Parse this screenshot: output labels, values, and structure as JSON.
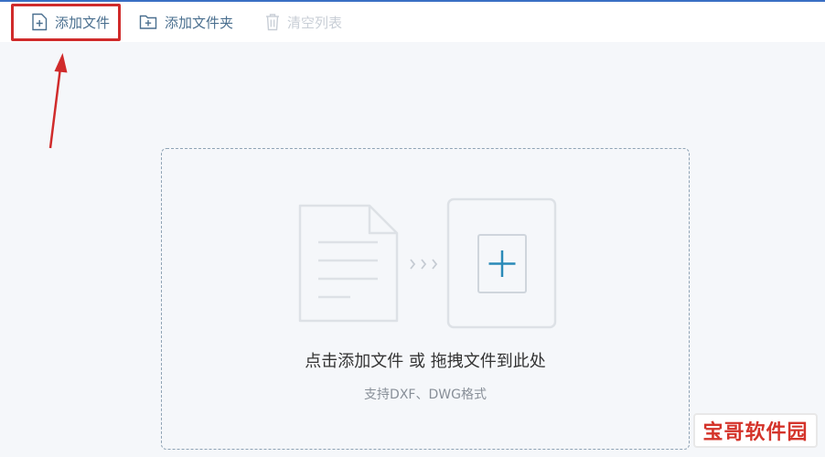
{
  "toolbar": {
    "add_file": "添加文件",
    "add_folder": "添加文件夹",
    "clear_list": "清空列表"
  },
  "drop_zone": {
    "title": "点击添加文件 或 拖拽文件到此处",
    "subtitle": "支持DXF、DWG格式"
  },
  "watermark": {
    "text": "宝哥软件园"
  },
  "colors": {
    "accent": "#3a6fc4",
    "icon": "#4a6f8f",
    "highlight": "#d02b2b",
    "plus": "#2a8ab8"
  }
}
